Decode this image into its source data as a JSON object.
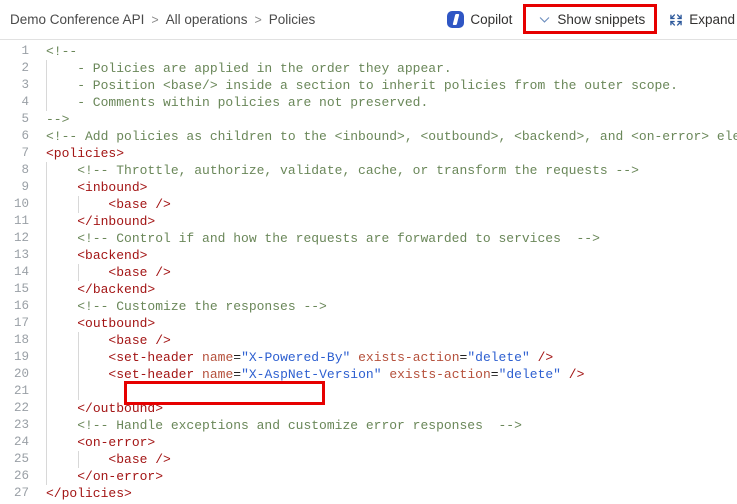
{
  "header": {
    "breadcrumb": {
      "items": [
        "Demo Conference API",
        "All operations",
        "Policies"
      ],
      "separator": ">"
    },
    "actions": {
      "copilot": {
        "label": "Copilot",
        "icon": "copilot-icon"
      },
      "show_snippets": {
        "label": "Show snippets",
        "icon": "chevron-down-icon"
      },
      "expand": {
        "label": "Expand",
        "icon": "expand-arrows-icon"
      }
    }
  },
  "annotations": {
    "accent_color": "#e60000",
    "boxes": [
      "show-snippets-highlight",
      "line-21-highlight"
    ]
  },
  "colors": {
    "comment": "#6a8759",
    "tag": "#a31515",
    "attribute": "#b5503b",
    "value": "#2d5fd0",
    "line_number": "#9aa0a6",
    "copilot_blue": "#2f56c4",
    "chevron": "#6f8fbf"
  },
  "editor": {
    "language": "xml",
    "first_line": 1,
    "last_line": 27,
    "lines": [
      {
        "n": "1",
        "guides": 0,
        "tokens": [
          {
            "t": "comment",
            "s": "<!--"
          }
        ]
      },
      {
        "n": "2",
        "guides": 1,
        "tokens": [
          {
            "t": "comment",
            "s": "    - Policies are applied in the order they appear."
          }
        ]
      },
      {
        "n": "3",
        "guides": 1,
        "tokens": [
          {
            "t": "comment",
            "s": "    - Position <base/> inside a section to inherit policies from the outer scope."
          }
        ]
      },
      {
        "n": "4",
        "guides": 1,
        "tokens": [
          {
            "t": "comment",
            "s": "    - Comments within policies are not preserved."
          }
        ]
      },
      {
        "n": "5",
        "guides": 0,
        "tokens": [
          {
            "t": "comment",
            "s": "-->"
          }
        ]
      },
      {
        "n": "6",
        "guides": 0,
        "tokens": [
          {
            "t": "comment",
            "s": "<!-- Add policies as children to the <inbound>, <outbound>, <backend>, and <on-error> ele"
          }
        ]
      },
      {
        "n": "7",
        "guides": 0,
        "tokens": [
          {
            "t": "tag",
            "s": "<policies>"
          }
        ]
      },
      {
        "n": "8",
        "guides": 1,
        "tokens": [
          {
            "t": "comment",
            "s": "    <!-- Throttle, authorize, validate, cache, or transform the requests -->"
          }
        ]
      },
      {
        "n": "9",
        "guides": 1,
        "tokens": [
          {
            "t": "plain",
            "s": "    "
          },
          {
            "t": "tag",
            "s": "<inbound>"
          }
        ]
      },
      {
        "n": "10",
        "guides": 2,
        "tokens": [
          {
            "t": "plain",
            "s": "        "
          },
          {
            "t": "tag",
            "s": "<base />"
          }
        ]
      },
      {
        "n": "11",
        "guides": 1,
        "tokens": [
          {
            "t": "plain",
            "s": "    "
          },
          {
            "t": "tag",
            "s": "</inbound>"
          }
        ]
      },
      {
        "n": "12",
        "guides": 1,
        "tokens": [
          {
            "t": "comment",
            "s": "    <!-- Control if and how the requests are forwarded to services  -->"
          }
        ]
      },
      {
        "n": "13",
        "guides": 1,
        "tokens": [
          {
            "t": "plain",
            "s": "    "
          },
          {
            "t": "tag",
            "s": "<backend>"
          }
        ]
      },
      {
        "n": "14",
        "guides": 2,
        "tokens": [
          {
            "t": "plain",
            "s": "        "
          },
          {
            "t": "tag",
            "s": "<base />"
          }
        ]
      },
      {
        "n": "15",
        "guides": 1,
        "tokens": [
          {
            "t": "plain",
            "s": "    "
          },
          {
            "t": "tag",
            "s": "</backend>"
          }
        ]
      },
      {
        "n": "16",
        "guides": 1,
        "tokens": [
          {
            "t": "comment",
            "s": "    <!-- Customize the responses -->"
          }
        ]
      },
      {
        "n": "17",
        "guides": 1,
        "tokens": [
          {
            "t": "plain",
            "s": "    "
          },
          {
            "t": "tag",
            "s": "<outbound>"
          }
        ]
      },
      {
        "n": "18",
        "guides": 2,
        "tokens": [
          {
            "t": "plain",
            "s": "        "
          },
          {
            "t": "tag",
            "s": "<base />"
          }
        ]
      },
      {
        "n": "19",
        "guides": 2,
        "tokens": [
          {
            "t": "plain",
            "s": "        "
          },
          {
            "t": "tag",
            "s": "<set-header "
          },
          {
            "t": "attr",
            "s": "name"
          },
          {
            "t": "punct",
            "s": "="
          },
          {
            "t": "val",
            "s": "\"X-Powered-By\""
          },
          {
            "t": "plain",
            "s": " "
          },
          {
            "t": "attr",
            "s": "exists-action"
          },
          {
            "t": "punct",
            "s": "="
          },
          {
            "t": "val",
            "s": "\"delete\""
          },
          {
            "t": "tag",
            "s": " />"
          }
        ]
      },
      {
        "n": "20",
        "guides": 2,
        "tokens": [
          {
            "t": "plain",
            "s": "        "
          },
          {
            "t": "tag",
            "s": "<set-header "
          },
          {
            "t": "attr",
            "s": "name"
          },
          {
            "t": "punct",
            "s": "="
          },
          {
            "t": "val",
            "s": "\"X-AspNet-Version\""
          },
          {
            "t": "plain",
            "s": " "
          },
          {
            "t": "attr",
            "s": "exists-action"
          },
          {
            "t": "punct",
            "s": "="
          },
          {
            "t": "val",
            "s": "\"delete\""
          },
          {
            "t": "tag",
            "s": " />"
          }
        ]
      },
      {
        "n": "21",
        "guides": 2,
        "tokens": [
          {
            "t": "plain",
            "s": ""
          }
        ]
      },
      {
        "n": "22",
        "guides": 1,
        "tokens": [
          {
            "t": "plain",
            "s": "    "
          },
          {
            "t": "tag",
            "s": "</outbound>"
          }
        ]
      },
      {
        "n": "23",
        "guides": 1,
        "tokens": [
          {
            "t": "comment",
            "s": "    <!-- Handle exceptions and customize error responses  -->"
          }
        ]
      },
      {
        "n": "24",
        "guides": 1,
        "tokens": [
          {
            "t": "plain",
            "s": "    "
          },
          {
            "t": "tag",
            "s": "<on-error>"
          }
        ]
      },
      {
        "n": "25",
        "guides": 2,
        "tokens": [
          {
            "t": "plain",
            "s": "        "
          },
          {
            "t": "tag",
            "s": "<base />"
          }
        ]
      },
      {
        "n": "26",
        "guides": 1,
        "tokens": [
          {
            "t": "plain",
            "s": "    "
          },
          {
            "t": "tag",
            "s": "</on-error>"
          }
        ]
      },
      {
        "n": "27",
        "guides": 0,
        "tokens": [
          {
            "t": "tag",
            "s": "</policies>"
          }
        ]
      }
    ]
  }
}
